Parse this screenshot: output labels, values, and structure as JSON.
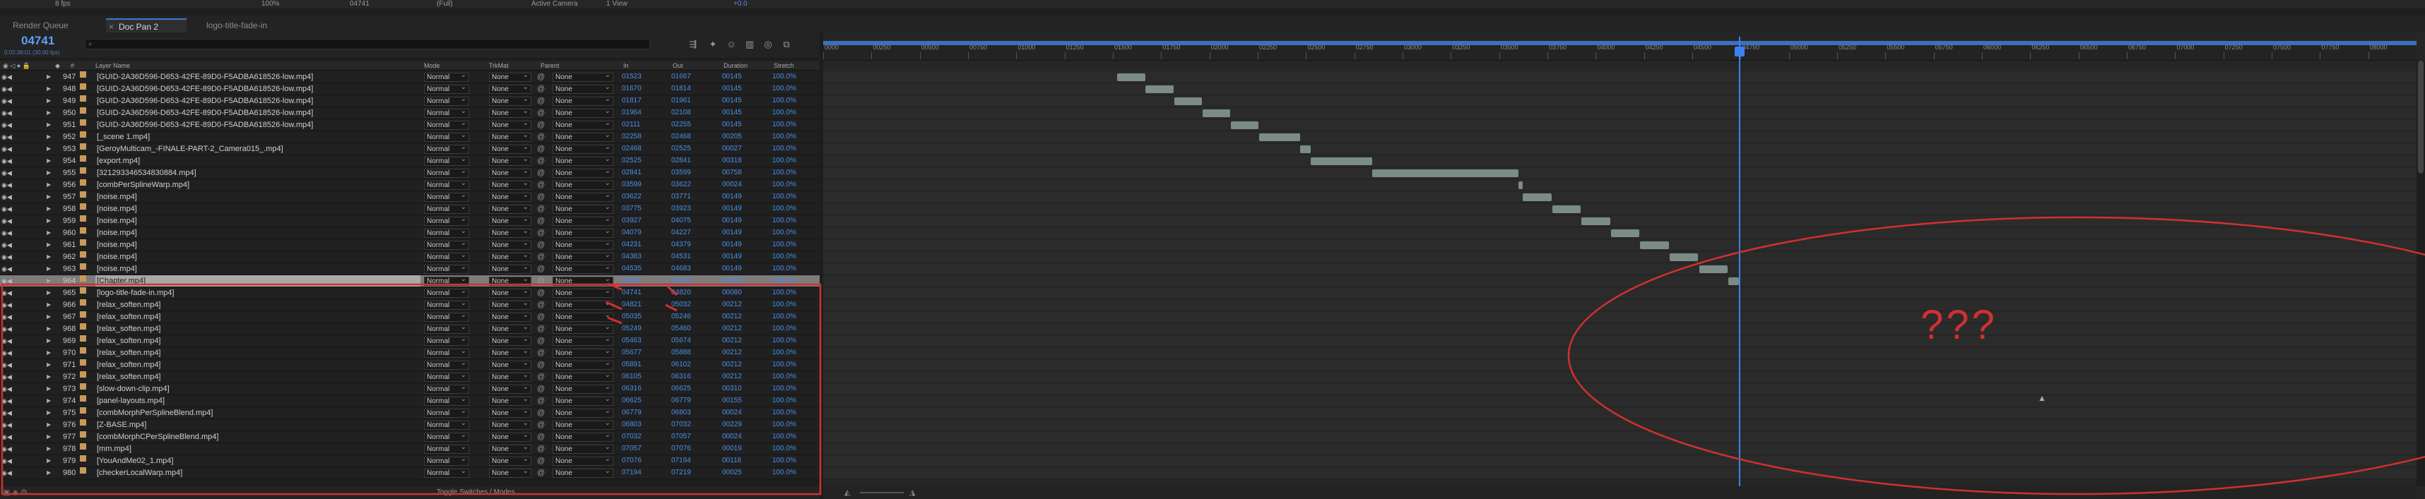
{
  "topbar": {
    "fps": "8 fps",
    "zoom": "100%",
    "timecode": "04741",
    "resolution": "(Full)",
    "view": "Active Camera",
    "views": "1 View",
    "exposure": "+0.0"
  },
  "tabs": [
    {
      "label": "Render Queue"
    },
    {
      "label": "Doc Pan 2"
    },
    {
      "label": "logo-title-fade-in"
    }
  ],
  "timecode": {
    "value": "04741",
    "sub": "0:02:38:01 (30.00 fps)"
  },
  "columns": {
    "layer_name": "Layer Name",
    "mode": "Mode",
    "trkmat": "TrkMat",
    "parent": "Parent",
    "in": "In",
    "out": "Out",
    "duration": "Duration",
    "stretch": "Stretch"
  },
  "layers": [
    {
      "num": "947",
      "name": "[GUID-2A36D596-D653-42FE-89D0-F5ADBA618526-low.mp4]",
      "in": "01523",
      "out": "01667",
      "dur": "00145"
    },
    {
      "num": "948",
      "name": "[GUID-2A36D596-D653-42FE-89D0-F5ADBA618526-low.mp4]",
      "in": "01670",
      "out": "01814",
      "dur": "00145"
    },
    {
      "num": "949",
      "name": "[GUID-2A36D596-D653-42FE-89D0-F5ADBA618526-low.mp4]",
      "in": "01817",
      "out": "01961",
      "dur": "00145"
    },
    {
      "num": "950",
      "name": "[GUID-2A36D596-D653-42FE-89D0-F5ADBA618526-low.mp4]",
      "in": "01964",
      "out": "02108",
      "dur": "00145"
    },
    {
      "num": "951",
      "name": "[GUID-2A36D596-D653-42FE-89D0-F5ADBA618526-low.mp4]",
      "in": "02111",
      "out": "02255",
      "dur": "00145"
    },
    {
      "num": "952",
      "name": "[_scene 1.mp4]",
      "in": "02258",
      "out": "02468",
      "dur": "00205"
    },
    {
      "num": "953",
      "name": "[GeroyMulticam_-FINALE-PART-2_Camera015_.mp4]",
      "in": "02468",
      "out": "02525",
      "dur": "00027"
    },
    {
      "num": "954",
      "name": "[export.mp4]",
      "in": "02525",
      "out": "02841",
      "dur": "00318"
    },
    {
      "num": "955",
      "name": "[321293346534830884.mp4]",
      "in": "02841",
      "out": "03599",
      "dur": "00758"
    },
    {
      "num": "956",
      "name": "[combPerSplineWarp.mp4]",
      "in": "03599",
      "out": "03622",
      "dur": "00024"
    },
    {
      "num": "957",
      "name": "[noise.mp4]",
      "in": "03622",
      "out": "03771",
      "dur": "00149"
    },
    {
      "num": "958",
      "name": "[noise.mp4]",
      "in": "03775",
      "out": "03923",
      "dur": "00149"
    },
    {
      "num": "959",
      "name": "[noise.mp4]",
      "in": "03927",
      "out": "04075",
      "dur": "00149"
    },
    {
      "num": "960",
      "name": "[noise.mp4]",
      "in": "04079",
      "out": "04227",
      "dur": "00149"
    },
    {
      "num": "961",
      "name": "[noise.mp4]",
      "in": "04231",
      "out": "04379",
      "dur": "00149"
    },
    {
      "num": "962",
      "name": "[noise.mp4]",
      "in": "04383",
      "out": "04531",
      "dur": "00149"
    },
    {
      "num": "963",
      "name": "[noise.mp4]",
      "in": "04535",
      "out": "04683",
      "dur": "00149"
    },
    {
      "num": "964",
      "name": "[Chapter.mp4]",
      "in": "04687",
      "out": "04741",
      "dur": "00055"
    },
    {
      "num": "965",
      "name": "[logo-title-fade-in.mp4]",
      "in": "04741",
      "out": "04820",
      "dur": "00080"
    },
    {
      "num": "966",
      "name": "[relax_soften.mp4]",
      "in": "04821",
      "out": "05032",
      "dur": "00212"
    },
    {
      "num": "967",
      "name": "[relax_soften.mp4]",
      "in": "05035",
      "out": "05246",
      "dur": "00212"
    },
    {
      "num": "968",
      "name": "[relax_soften.mp4]",
      "in": "05249",
      "out": "05460",
      "dur": "00212"
    },
    {
      "num": "969",
      "name": "[relax_soften.mp4]",
      "in": "05463",
      "out": "05674",
      "dur": "00212"
    },
    {
      "num": "970",
      "name": "[relax_soften.mp4]",
      "in": "05677",
      "out": "05888",
      "dur": "00212"
    },
    {
      "num": "971",
      "name": "[relax_soften.mp4]",
      "in": "05891",
      "out": "06102",
      "dur": "00212"
    },
    {
      "num": "972",
      "name": "[relax_soften.mp4]",
      "in": "06105",
      "out": "06316",
      "dur": "00212"
    },
    {
      "num": "973",
      "name": "[slow-down-clip.mp4]",
      "in": "06316",
      "out": "06625",
      "dur": "00310"
    },
    {
      "num": "974",
      "name": "[panel-layouts.mp4]",
      "in": "06625",
      "out": "06779",
      "dur": "00155"
    },
    {
      "num": "975",
      "name": "[combMorphPerSplineBlend.mp4]",
      "in": "06779",
      "out": "06803",
      "dur": "00024"
    },
    {
      "num": "976",
      "name": "[Z-BASE.mp4]",
      "in": "06803",
      "out": "07032",
      "dur": "00229"
    },
    {
      "num": "977",
      "name": "[combMorphCPerSplineBlend.mp4]",
      "in": "07032",
      "out": "07057",
      "dur": "00024"
    },
    {
      "num": "978",
      "name": "[mm.mp4]",
      "in": "07057",
      "out": "07076",
      "dur": "00019"
    },
    {
      "num": "979",
      "name": "[YouAndMe02_1.mp4]",
      "in": "07076",
      "out": "07194",
      "dur": "00118"
    },
    {
      "num": "980",
      "name": "[checkerLocalWarp.mp4]",
      "in": "07194",
      "out": "07219",
      "dur": "00025"
    }
  ],
  "defaults": {
    "mode": "Normal",
    "trkmat": "None",
    "parent": "None",
    "stretch": "100.0%"
  },
  "ruler": [
    "0000",
    "00250",
    "00500",
    "00750",
    "01000",
    "01250",
    "01500",
    "01750",
    "02000",
    "02250",
    "02500",
    "02750",
    "03000",
    "03250",
    "03500",
    "03750",
    "04000",
    "04250",
    "04500",
    "04750",
    "05000",
    "05250",
    "05500",
    "05750",
    "06000",
    "06250",
    "06500",
    "06750",
    "07000",
    "07250",
    "07500",
    "07750",
    "08000"
  ],
  "selected_layer": "964",
  "current_frame": 4741,
  "footer": {
    "toggle_label": "Toggle Switches / Modes"
  },
  "annotation": {
    "text": "???",
    "color": "#d23030"
  }
}
